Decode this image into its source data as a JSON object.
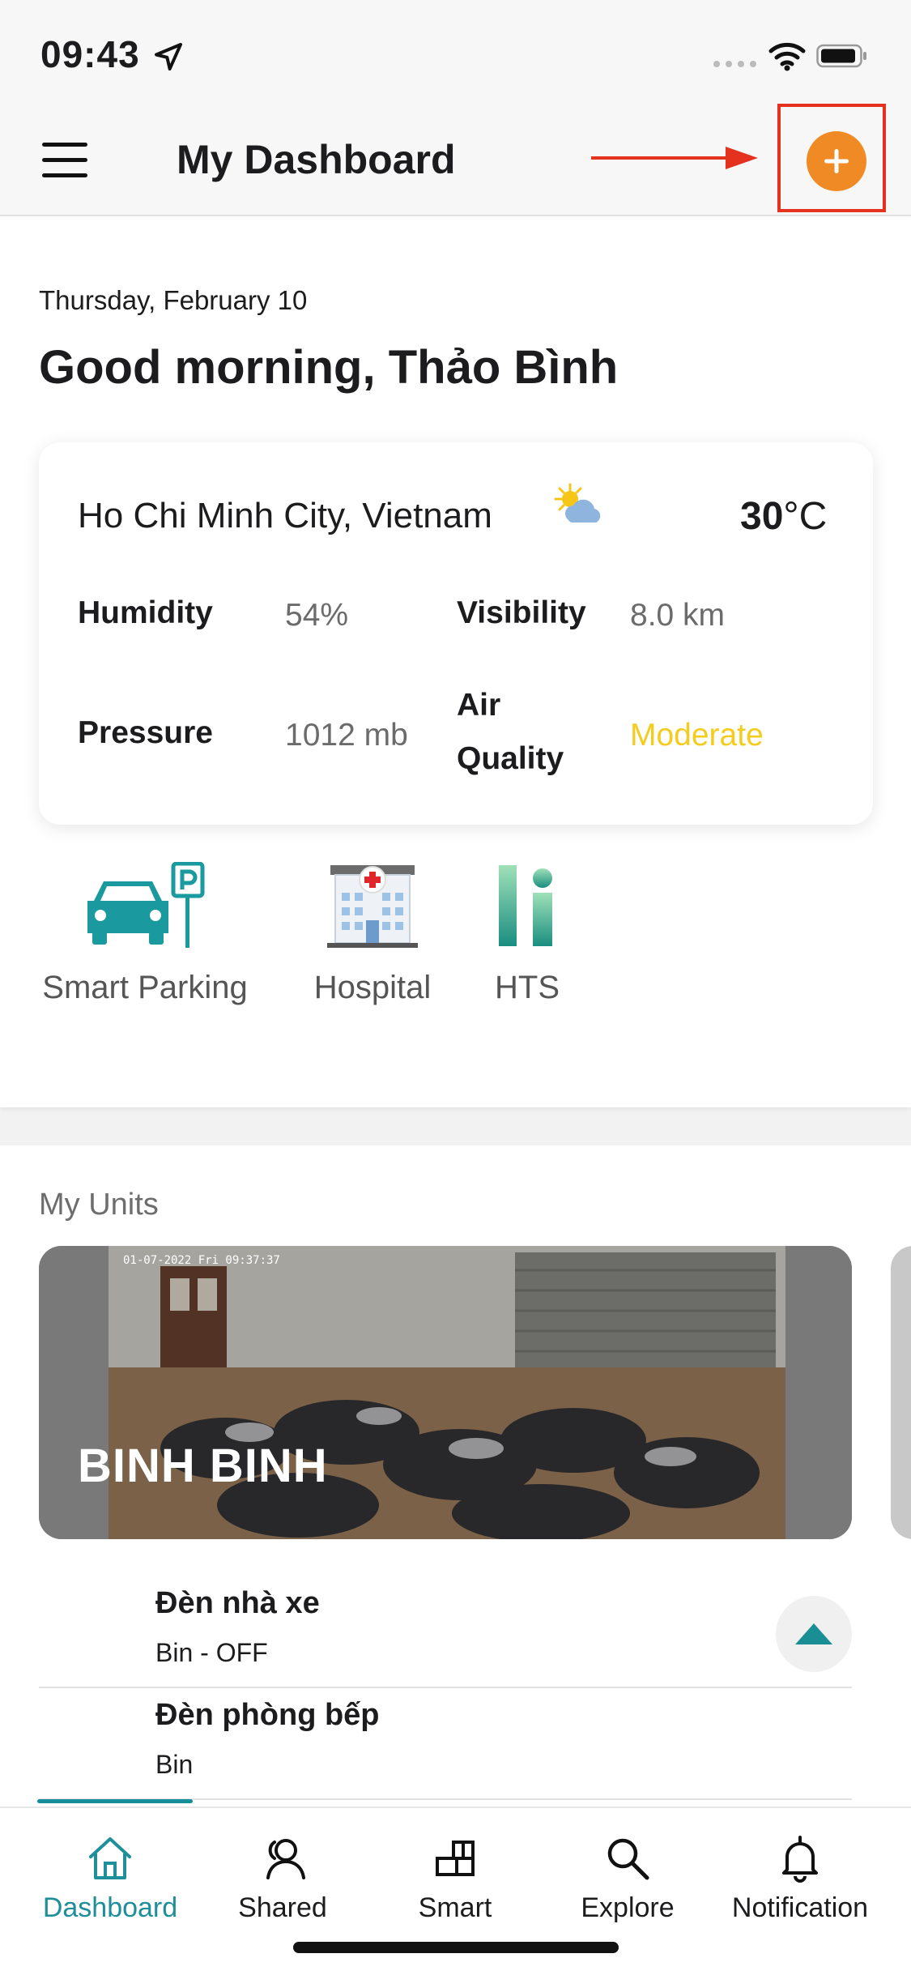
{
  "status_bar": {
    "time": "09:43"
  },
  "header": {
    "title": "My Dashboard"
  },
  "greeting": {
    "date": "Thursday, February 10",
    "message": "Good morning, Thảo Bình"
  },
  "weather": {
    "city": "Ho Chi Minh City, Vietnam",
    "temperature": "30",
    "unit": "°C",
    "humidity_label": "Humidity",
    "humidity_value": "54%",
    "visibility_label": "Visibility",
    "visibility_value": "8.0 km",
    "pressure_label": "Pressure",
    "pressure_value": "1012 mb",
    "air_quality_label_line1": "Air",
    "air_quality_label_line2": "Quality",
    "air_quality_value": "Moderate",
    "air_quality_color": "#f4cc1d",
    "icon": "partly-sunny-icon"
  },
  "features": [
    {
      "label": "Smart Parking",
      "icon": "smart-parking-icon"
    },
    {
      "label": "Hospital",
      "icon": "hospital-icon"
    },
    {
      "label": "HTS",
      "icon": "hts-icon"
    }
  ],
  "units": {
    "section_label": "My Units",
    "card": {
      "name": "BINH BINH",
      "camera_overlay": "01-07-2022 Fri 09:37:37"
    },
    "devices": [
      {
        "name": "Đèn nhà xe",
        "status": "Bin - OFF"
      },
      {
        "name": "Đèn phòng  bếp",
        "status": "Bin"
      }
    ]
  },
  "bottom_nav": {
    "items": [
      {
        "label": "Dashboard",
        "icon": "home-icon",
        "active": true
      },
      {
        "label": "Shared",
        "icon": "shared-user-icon",
        "active": false
      },
      {
        "label": "Smart",
        "icon": "smart-blocks-icon",
        "active": false
      },
      {
        "label": "Explore",
        "icon": "search-icon",
        "active": false
      },
      {
        "label": "Notification",
        "icon": "bell-icon",
        "active": false
      }
    ]
  },
  "colors": {
    "accent": "#1e8e9a",
    "add_button": "#f08a24",
    "annotation": "#e4321e"
  }
}
